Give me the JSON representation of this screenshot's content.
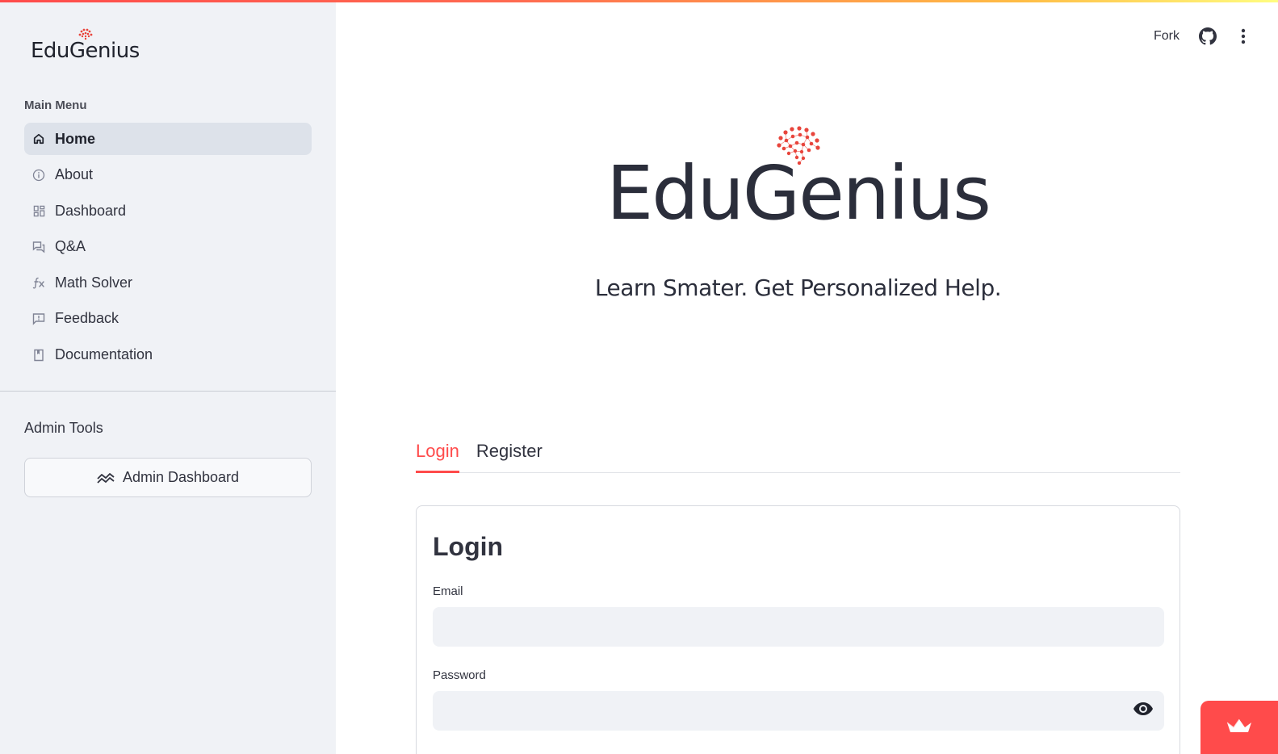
{
  "brand": {
    "sidebar_logo": "EduGenius",
    "hero_title": "EduGenius",
    "tagline": "Learn Smater. Get Personalized Help.",
    "accent_color": "#ff4b4b"
  },
  "sidebar": {
    "menu_title": "Main Menu",
    "items": [
      {
        "label": "Home",
        "icon": "home-icon",
        "active": true
      },
      {
        "label": "About",
        "icon": "info-icon",
        "active": false
      },
      {
        "label": "Dashboard",
        "icon": "dashboard-icon",
        "active": false
      },
      {
        "label": "Q&A",
        "icon": "chat-icon",
        "active": false
      },
      {
        "label": "Math Solver",
        "icon": "function-icon",
        "active": false
      },
      {
        "label": "Feedback",
        "icon": "feedback-icon",
        "active": false
      },
      {
        "label": "Documentation",
        "icon": "book-icon",
        "active": false
      }
    ],
    "admin_title": "Admin Tools",
    "admin_button": "Admin Dashboard"
  },
  "header": {
    "fork_label": "Fork"
  },
  "tabs": [
    {
      "label": "Login",
      "active": true
    },
    {
      "label": "Register",
      "active": false
    }
  ],
  "login_form": {
    "heading": "Login",
    "email_label": "Email",
    "email_value": "",
    "password_label": "Password",
    "password_value": ""
  }
}
